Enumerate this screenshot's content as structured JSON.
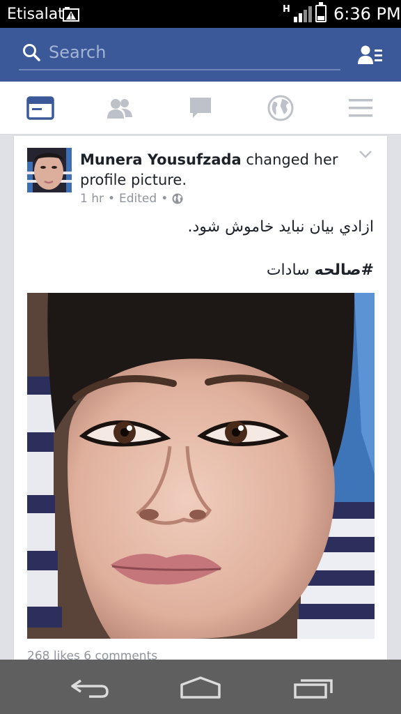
{
  "status_bar": {
    "carrier": "Etisalat",
    "network_type": "H",
    "time": "6:36 PM",
    "battery_level": 0.3,
    "icons": [
      "warning-icon",
      "signal-icon",
      "battery-icon"
    ]
  },
  "header": {
    "search_placeholder": "Search",
    "icons": [
      "search-icon",
      "friend-requests-icon"
    ],
    "colors": {
      "header_bg": "#3b5998",
      "accent": "#3b5998"
    }
  },
  "nav_tabs": [
    {
      "name": "news-feed",
      "icon": "news-feed-icon",
      "active": true
    },
    {
      "name": "friends",
      "icon": "friends-icon",
      "active": false
    },
    {
      "name": "messages",
      "icon": "chat-icon",
      "active": false
    },
    {
      "name": "notifications",
      "icon": "globe-icon",
      "active": false
    },
    {
      "name": "more",
      "icon": "menu-icon",
      "active": false
    }
  ],
  "post": {
    "author": "Munera Yousufzada",
    "action": " changed her profile picture.",
    "time": "1 hr",
    "edited": "Edited",
    "separator": "•",
    "audience_icon": "globe-icon",
    "text_line1": "ازادي بيان نبايد خاموش شود.",
    "hashtag": "#صالحه",
    "hashtag_suffix": "  سادات",
    "stats": "268 likes  6 comments"
  },
  "system_nav": {
    "icons": [
      "back-icon",
      "home-icon",
      "recent-apps-icon"
    ]
  }
}
